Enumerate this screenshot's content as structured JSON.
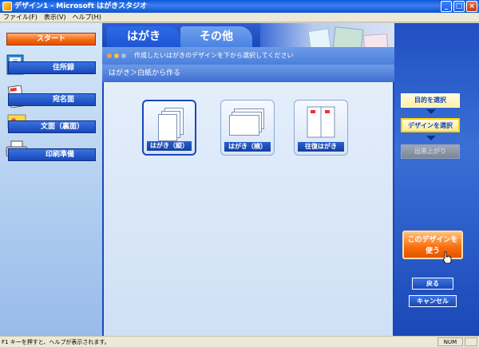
{
  "window": {
    "title": "デザイン1 - Microsoft はがきスタジオ",
    "controls": {
      "minimize": "_",
      "maximize": "□",
      "close": "×"
    }
  },
  "menu": [
    "ファイル(F)",
    "表示(V)",
    "ヘルプ(H)"
  ],
  "sidebar": {
    "start": "スタート",
    "items": [
      {
        "label": "住所録",
        "icon": "address-book-icon"
      },
      {
        "label": "宛名面",
        "icon": "address-face-icon"
      },
      {
        "label": "文面（裏面）",
        "icon": "message-face-icon"
      },
      {
        "label": "印刷準備",
        "icon": "printer-icon"
      }
    ]
  },
  "tabs": [
    {
      "label": "はがき",
      "active": true
    },
    {
      "label": "その他",
      "active": false
    }
  ],
  "instruction": "作成したいはがきのデザインを下から選択してください",
  "breadcrumb": "はがき＞白紙から作る",
  "templates": [
    {
      "label": "はがき（縦）",
      "selected": true
    },
    {
      "label": "はがき（横）",
      "selected": false
    },
    {
      "label": "往復はがき",
      "selected": false
    }
  ],
  "steps": [
    {
      "label": "目的を選択",
      "state": "done"
    },
    {
      "label": "デザインを選択",
      "state": "current"
    },
    {
      "label": "出来上がり",
      "state": "next"
    }
  ],
  "actions": {
    "use_design_line1": "このデザインを",
    "use_design_line2": "使う",
    "back": "戻る",
    "cancel": "キャンセル"
  },
  "status": {
    "text": "F1 キーを押すと、ヘルプが表示されます。",
    "num": "NUM"
  },
  "colors": {
    "accent_orange": "#f2660e",
    "primary_blue": "#1848b8",
    "step_highlight": "#fff0a8"
  }
}
